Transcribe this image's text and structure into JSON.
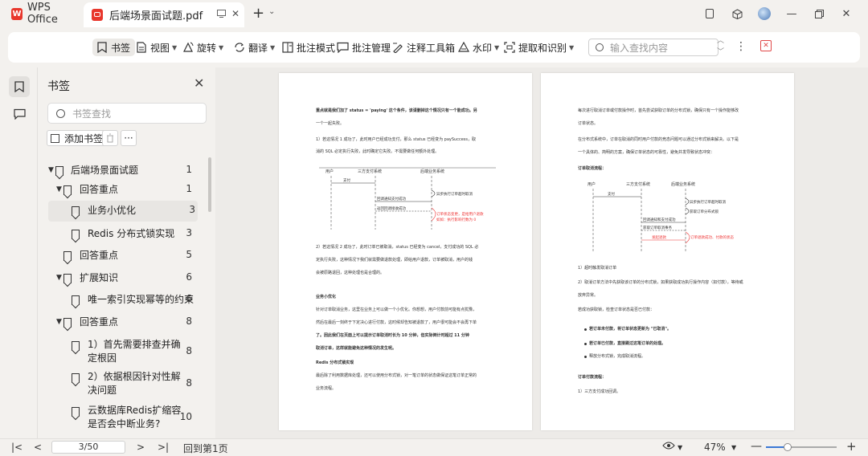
{
  "app": {
    "name": "WPS Office",
    "logo_letter": "W"
  },
  "tab": {
    "title": "后端场景面试题.pdf"
  },
  "toolbar": {
    "items": [
      {
        "label": "书签",
        "icon": "bookmark-icon",
        "dropdown": false,
        "active": true
      },
      {
        "label": "视图",
        "icon": "view-icon",
        "dropdown": true
      },
      {
        "label": "旋转",
        "icon": "rotate-icon",
        "dropdown": true
      },
      {
        "label": "翻译",
        "icon": "translate-icon",
        "dropdown": true
      },
      {
        "label": "批注模式",
        "icon": "annotate-mode-icon",
        "dropdown": false
      },
      {
        "label": "批注管理",
        "icon": "comment-manage-icon",
        "dropdown": false
      },
      {
        "label": "注释工具箱",
        "icon": "annotation-toolbox-icon",
        "dropdown": false
      },
      {
        "label": "水印",
        "icon": "watermark-icon",
        "dropdown": true
      },
      {
        "label": "提取和识别",
        "icon": "extract-icon",
        "dropdown": true
      }
    ],
    "search_placeholder": "输入查找内容"
  },
  "bookmarks": {
    "title": "书签",
    "search_placeholder": "书签查找",
    "add_label": "添加书签",
    "more_label": "···",
    "items": [
      {
        "label": "后端场景面试题",
        "page": "1",
        "expanded": true
      },
      {
        "label": "回答重点",
        "page": "1",
        "expanded": true
      },
      {
        "label": "业务小优化",
        "page": "3",
        "selected": true
      },
      {
        "label": "Redis 分布式锁实现",
        "page": "3"
      },
      {
        "label": "回答重点",
        "page": "5"
      },
      {
        "label": "扩展知识",
        "page": "6",
        "expanded": true
      },
      {
        "label": "唯一索引实现幂等的约束",
        "page": "6"
      },
      {
        "label": "回答重点",
        "page": "8",
        "expanded": true
      },
      {
        "label": "1）首先需要排查并确定根因",
        "page": "8"
      },
      {
        "label": "2）依据根因针对性解决问题",
        "page": "8"
      },
      {
        "label": "云数据库Redis扩缩容是否会中断业务?",
        "page": "10"
      }
    ]
  },
  "statusbar": {
    "page_indicator": "3/50",
    "back_to_first": "回到第1页",
    "zoom": "47%",
    "zoom_level": 0.3
  },
  "document": {
    "left_page": {
      "lines": [
        "重点就是我们加了 status = 'paying' 这个条件，该请删掉这个情况只有一个能成功。另",
        "一个一起失败。",
        "1）若这情况 1 成功了，此时用户已经成功支付，那么 status 已经变为 paySuccess，取",
        "消的 SQL 必定执行失败，此时确定它失败。不需要做任何额外处理。",
        "2）若这情况 2 成功了，此时订单已被取消，status 已经变为 cancel，支付成功的 SQL 必",
        "定执行失败，这种情况下我们就需要做退款处理，即给用户退款，订单被取消，用户的钱",
        "会被原路退回，这种处理也是合理的。",
        "业务小优化",
        "针对订单取消业务，这里在业务上可以做一个小优化。你想想，用户付款前可能有点犹豫，",
        "然后在最后一刻终于下定决心进行付款，这时候却告知被退款了，用户很可能会不会再下单",
        "了。因此我们在页面上可以提示订单取消时长为 10 分钟，但实际倒计时超过 11 分钟",
        "取消订单，这样就能避免这种情况的发生呢。",
        "Redis 分布式锁实现",
        "最后除了利用数据库处理，还可以使用分布式锁，对一笔订单的状态做保证这笔订单正常的",
        "业务流程。"
      ],
      "diagram": {
        "actors": [
          "用户",
          "三方支付系统",
          "后端业务系统"
        ],
        "messages": [
          "支付",
          "异步执行订单超时取消",
          "回调通知支付成功",
          "返回回调接收成功",
          "订单状态变更，是给用户退款",
          "如如：执行影响行数为 0"
        ]
      }
    },
    "right_page": {
      "lines": [
        "每次进行取消订单或付款操作时，首先尝试获取订单的分布式锁，确保只有一个操作能够改",
        "订单状态。",
        "在分布式系统中，订单在取消的同时用户付款的竞态问题可以通过分布式锁来解决。以下是",
        "一个具体的、简明的方案，确保订单状态的可靠性，避免并发导致状态冲突：",
        "订单取消流程：",
        "1）超时触发取消订单",
        "2）取消订单方法中先获取该订单的分布式锁，如果获取成功执行操作内容（如付款），等待或",
        "放弃异常。",
        "若成功获取锁，检查订单状态是否已付款：",
        "若订单未付款，将订单状态更新为 \"已取消\"。",
        "若订单已付款，直接跳过这笔订单的处理。",
        "释放分布式锁，完成取消流程。",
        "订单付款流程：",
        "1）三方支付成功回调。"
      ],
      "diagram": {
        "actors": [
          "用户",
          "三方支付系统",
          "后端业务系统"
        ],
        "messages": [
          "支付",
          "异步执行订单超时取消",
          "回调通知支付成功",
          "获取订单分布式锁",
          "回调通知和支付成功",
          "获取订单取消事务",
          "发起退款",
          "订单退款成功、付款的状态"
        ]
      }
    }
  }
}
